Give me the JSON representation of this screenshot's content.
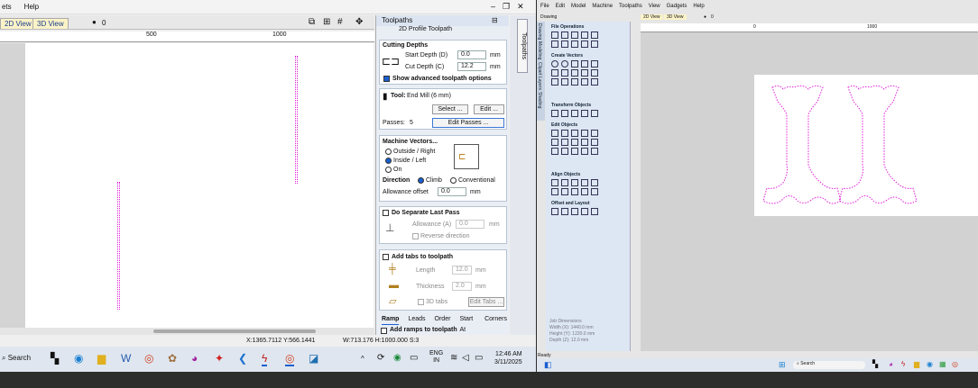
{
  "left_window": {
    "menu": [
      "ets",
      "Help"
    ],
    "view_tabs": [
      "2D View",
      "3D View"
    ],
    "counter": "0",
    "ruler_ticks": [
      "500",
      "1000"
    ],
    "status": {
      "coords": "X:1365.7112 Y:566.1441",
      "dims": "W:713.176  H:1000.000  S:3"
    }
  },
  "toolpaths_panel": {
    "title": "Toolpaths",
    "subtitle": "2D Profile Toolpath",
    "cutting_depths": {
      "heading": "Cutting Depths",
      "start_label": "Start Depth (D)",
      "start_value": "0.0",
      "cut_label": "Cut Depth (C)",
      "cut_value": "12.2",
      "unit": "mm",
      "advanced": "Show advanced toolpath options"
    },
    "tool": {
      "label": "Tool:",
      "value": "End Mill (6 mm)",
      "select": "Select ...",
      "edit": "Edit ...",
      "passes_label": "Passes:",
      "passes_value": "5",
      "edit_passes": "Edit Passes ..."
    },
    "machine_vectors": {
      "heading": "Machine Vectors...",
      "outside": "Outside / Right",
      "inside": "Inside / Left",
      "on": "On",
      "direction": "Direction",
      "climb": "Climb",
      "conventional": "Conventional",
      "allowance": "Allowance offset",
      "allowance_value": "0.0",
      "unit": "mm"
    },
    "separate_last": {
      "heading": "Do Separate Last Pass",
      "allowance": "Allowance (A)",
      "value": "0.0",
      "unit": "mm",
      "reverse": "Reverse direction"
    },
    "tabs": {
      "heading": "Add tabs to toolpath",
      "length": "Length",
      "length_value": "12.0",
      "thickness": "Thickness",
      "thickness_value": "2.0",
      "unit": "mm",
      "tabs3d": "3D tabs",
      "edit_tabs": "Edit Tabs ..."
    },
    "bottom_tabs": [
      "Ramp",
      "Leads",
      "Order",
      "Start At",
      "Corners"
    ],
    "ramps": "Add ramps to toolpath",
    "vertical_tab": "Toolpaths"
  },
  "taskbar": {
    "search": "Search",
    "lang": "ENG",
    "region": "IN",
    "time": "12:46 AM",
    "date": "3/11/2025"
  },
  "right_window": {
    "menu": [
      "File",
      "Edit",
      "Model",
      "Machine",
      "Toolpaths",
      "View",
      "Gadgets",
      "Help"
    ],
    "panel_title": "Drawing",
    "sections": [
      "File Operations",
      "Create Vectors",
      "Edit Objects",
      "Transform Objects",
      "Align Objects",
      "Offset and Layout"
    ],
    "view_tabs": [
      "2D View",
      "3D View"
    ],
    "counter": "0",
    "ruler_ticks": [
      "0",
      "1000"
    ],
    "side_tabs": [
      "Drawing",
      "Modeling",
      "Clipart",
      "Layers",
      "Shading"
    ],
    "job": {
      "title": "Job Dimensions",
      "width": "Width  (X): 1440.0 mm",
      "height": "Height (Y): 1220.0 mm",
      "depth": "Depth  (Z): 12.0 mm"
    },
    "ready": "Ready",
    "search": "Search"
  }
}
